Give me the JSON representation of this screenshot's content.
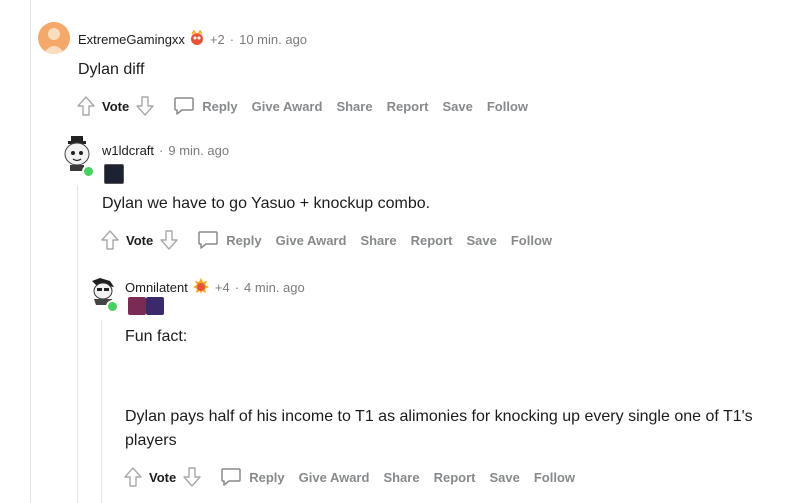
{
  "comments": [
    {
      "username": "ExtremeGamingxx",
      "award_count": "+2",
      "time": "10 min. ago",
      "text": "Dylan diff",
      "actions": {
        "vote": "Vote",
        "reply": "Reply",
        "give_award": "Give Award",
        "share": "Share",
        "report": "Report",
        "save": "Save",
        "follow": "Follow"
      }
    },
    {
      "username": "w1ldcraft",
      "time": "9 min. ago",
      "text": "Dylan we have to go Yasuo + knockup combo.",
      "actions": {
        "vote": "Vote",
        "reply": "Reply",
        "give_award": "Give Award",
        "share": "Share",
        "report": "Report",
        "save": "Save",
        "follow": "Follow"
      }
    },
    {
      "username": "Omnilatent",
      "award_count": "+4",
      "time": "4 min. ago",
      "text_line1": "Fun fact:",
      "text_line2": "Dylan pays half of his income to T1 as alimonies for knocking up every single one of T1's",
      "text_line3": "players",
      "actions": {
        "vote": "Vote",
        "reply": "Reply",
        "give_award": "Give Award",
        "share": "Share",
        "report": "Report",
        "save": "Save",
        "follow": "Follow"
      }
    }
  ],
  "separator": "·",
  "colors": {
    "action_gray": "#878a8c",
    "meta_gray": "#7c7c7c",
    "online_green": "#46d160",
    "thread_line": "#e3e3e3"
  }
}
